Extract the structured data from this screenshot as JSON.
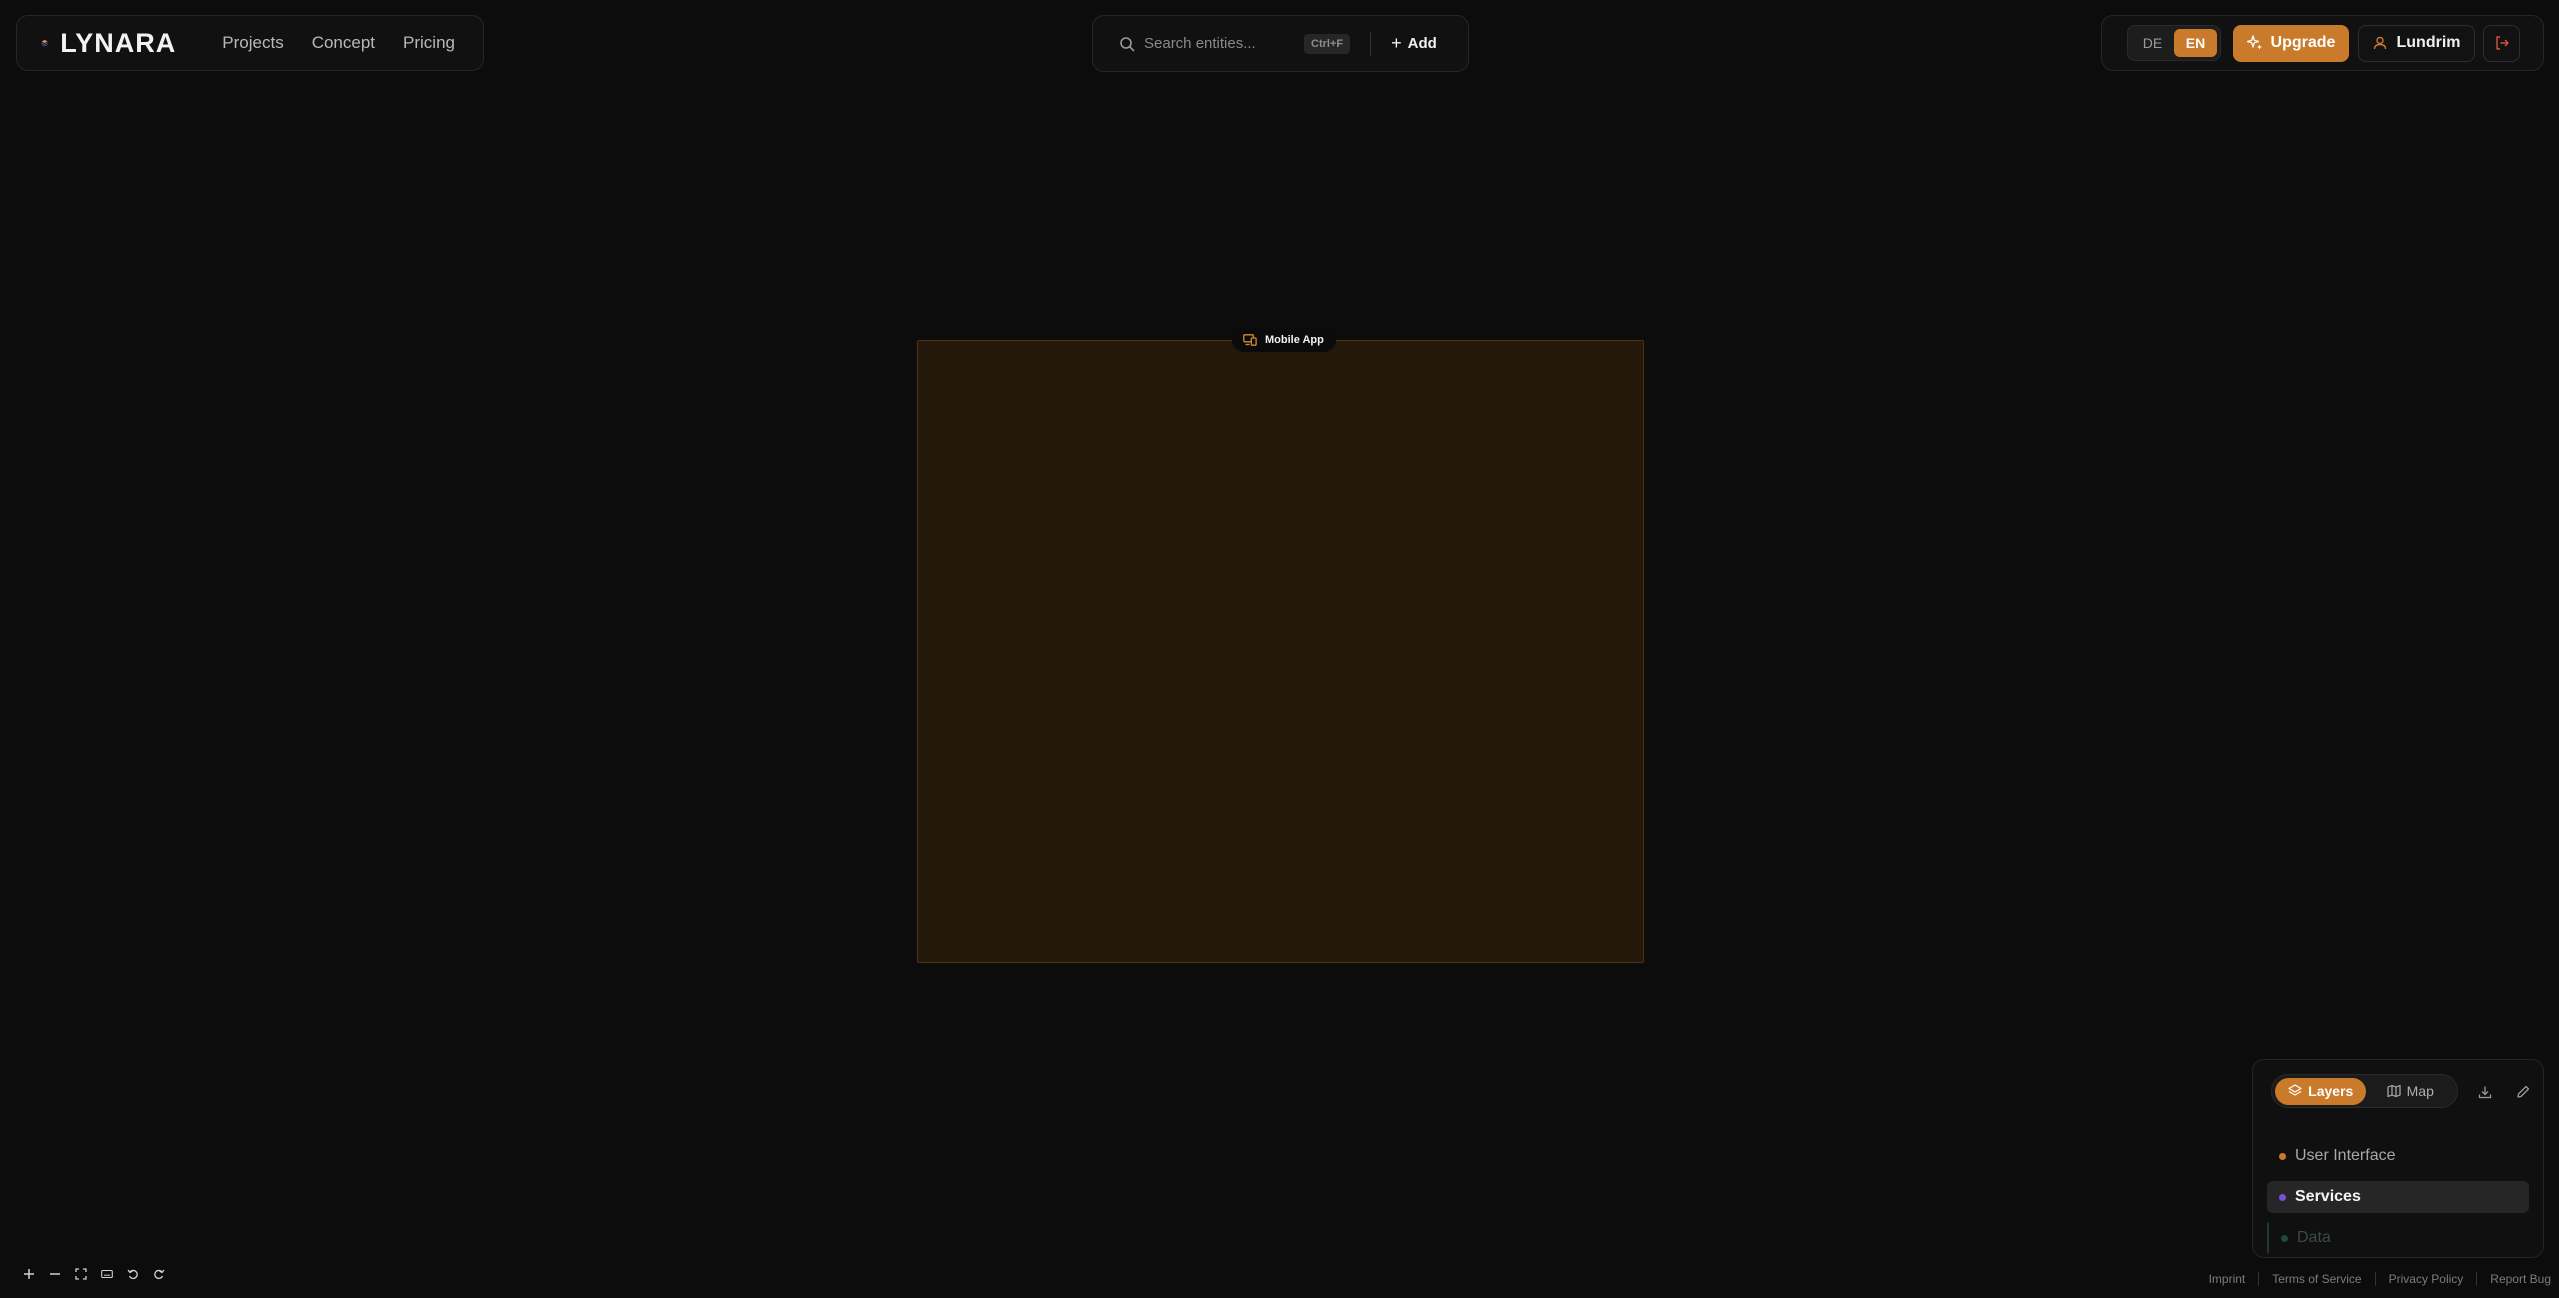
{
  "brand": {
    "name": "LYNARA"
  },
  "nav": {
    "items": [
      "Projects",
      "Concept",
      "Pricing"
    ]
  },
  "search": {
    "placeholder": "Search entities...",
    "shortcut": "Ctrl+F",
    "add_label": "Add"
  },
  "header_right": {
    "languages": [
      "DE",
      "EN"
    ],
    "active_language": "EN",
    "upgrade_label": "Upgrade",
    "user_name": "Lundrim"
  },
  "canvas": {
    "group_label": "Mobile App"
  },
  "layers_panel": {
    "tabs": [
      "Layers",
      "Map"
    ],
    "active_tab": "Layers",
    "items": [
      {
        "label": "User Interface",
        "color": "#c97a2a"
      },
      {
        "label": "Services",
        "color": "#7a4fe0"
      },
      {
        "label": "Data",
        "color": "#2f8a5a"
      }
    ],
    "selected_item": "Services"
  },
  "footer": {
    "links": [
      "Imprint",
      "Terms of Service",
      "Privacy Policy",
      "Report Bug"
    ]
  },
  "colors": {
    "accent": "#c97a2a",
    "background": "#0c0c0c",
    "group_fill": "#231809"
  }
}
